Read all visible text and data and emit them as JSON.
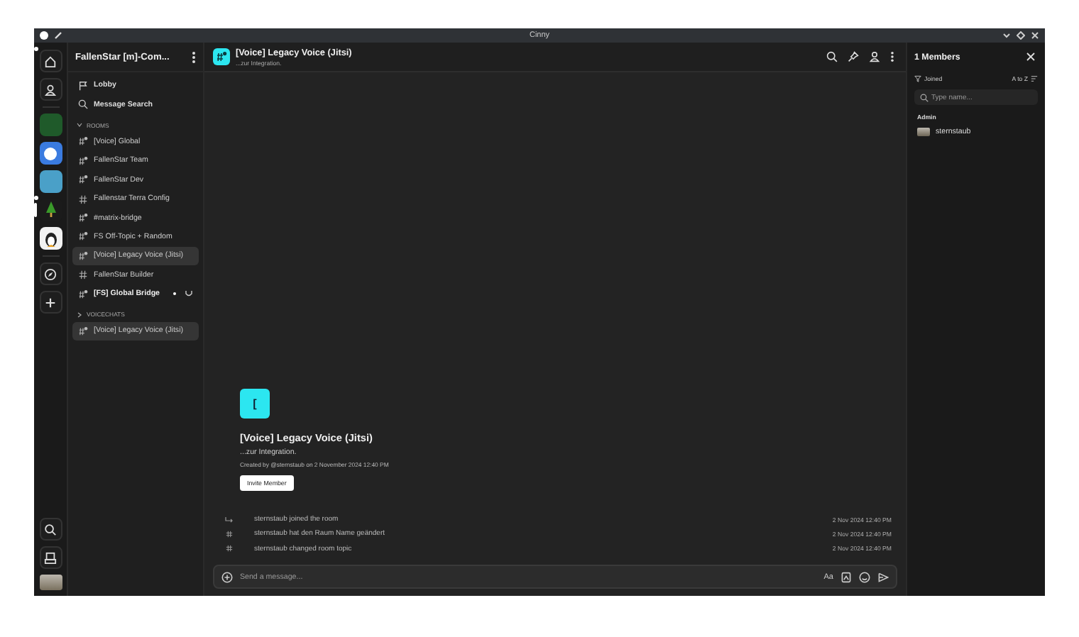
{
  "window": {
    "title": "Cinny"
  },
  "rail": {
    "top": [
      {
        "kind": "home",
        "unread": true
      },
      {
        "kind": "person",
        "unread": false
      }
    ],
    "spaces": [
      {
        "kind": "green",
        "selected": false,
        "unread": false
      },
      {
        "kind": "blue",
        "selected": false,
        "unread": false
      },
      {
        "kind": "cube",
        "selected": false,
        "unread": false
      },
      {
        "kind": "tree",
        "selected": true,
        "unread": true
      },
      {
        "kind": "penguin",
        "selected": false,
        "unread": false
      }
    ]
  },
  "sidebar": {
    "title": "FallenStar [m]-Com...",
    "links": [
      {
        "kind": "lobby",
        "label": "Lobby"
      },
      {
        "kind": "search",
        "label": "Message Search"
      }
    ],
    "categories": [
      {
        "label": "ROOMS",
        "expanded": true,
        "rooms": [
          {
            "kind": "voice",
            "label": "[Voice] Global",
            "selected": false,
            "unread": false
          },
          {
            "kind": "voice",
            "label": "FallenStar Team",
            "selected": false,
            "unread": false
          },
          {
            "kind": "voice",
            "label": "FallenStar Dev",
            "selected": false,
            "unread": false
          },
          {
            "kind": "text",
            "label": "Fallenstar Terra Config",
            "selected": false,
            "unread": false
          },
          {
            "kind": "voice",
            "label": "#matrix-bridge",
            "selected": false,
            "unread": false
          },
          {
            "kind": "voice",
            "label": "FS Off-Topic + Random",
            "selected": false,
            "unread": false
          },
          {
            "kind": "voice",
            "label": "[Voice] Legacy Voice (Jitsi)",
            "selected": true,
            "unread": false
          },
          {
            "kind": "text",
            "label": "FallenStar Builder",
            "selected": false,
            "unread": false
          },
          {
            "kind": "voice",
            "label": "[FS] Global Bridge",
            "selected": false,
            "unread": true
          }
        ]
      },
      {
        "label": "VOICECHATS",
        "expanded": false,
        "rooms": [
          {
            "kind": "voice",
            "label": "[Voice] Legacy Voice (Jitsi)",
            "selected": true,
            "unread": false
          }
        ]
      }
    ]
  },
  "room": {
    "name": "[Voice] Legacy Voice (Jitsi)",
    "topic": "...zur Integration."
  },
  "intro": {
    "avatar_letter": "[",
    "name": "[Voice] Legacy Voice (Jitsi)",
    "topic": "...zur Integration.",
    "created": "Created by @sternstaub on 2 November 2024 12:40 PM",
    "invite_button": "Invite Member"
  },
  "events": [
    {
      "kind": "join",
      "text": "sternstaub joined the room",
      "time": "2 Nov 2024 12:40 PM"
    },
    {
      "kind": "name",
      "text": "sternstaub hat den Raum Name geändert",
      "time": "2 Nov 2024 12:40 PM"
    },
    {
      "kind": "topic",
      "text": "sternstaub changed room topic",
      "time": "2 Nov 2024 12:40 PM"
    }
  ],
  "composer": {
    "placeholder": "Send a message...",
    "format_button": "Aa"
  },
  "members": {
    "title": "1 Members",
    "filter": "Joined",
    "sort": "A to Z",
    "search_placeholder": "Type name...",
    "groups": [
      {
        "label": "Admin",
        "members": [
          {
            "name": "sternstaub"
          }
        ]
      }
    ]
  }
}
